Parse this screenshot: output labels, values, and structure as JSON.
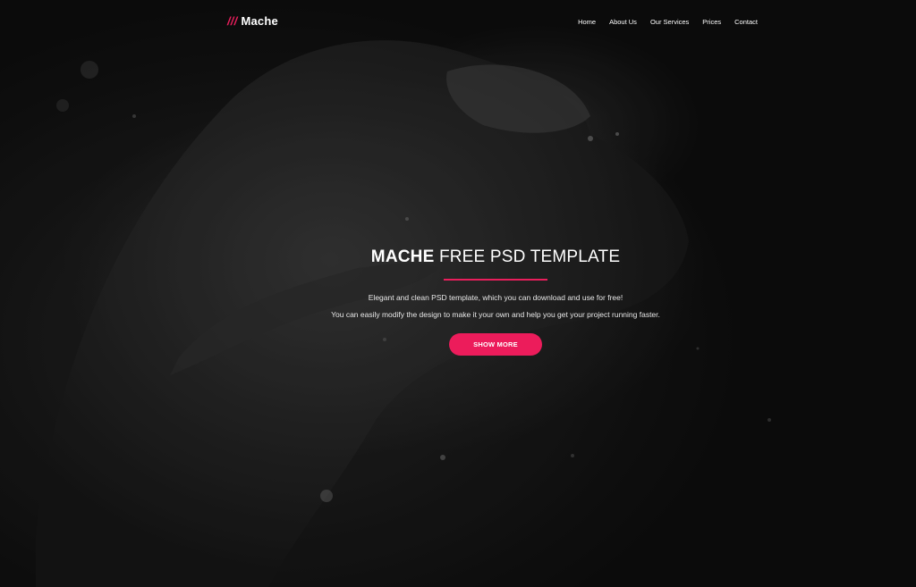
{
  "navbar": {
    "logo_slashes": "///",
    "logo_text": "Mache",
    "items": [
      {
        "label": "Home"
      },
      {
        "label": "About Us"
      },
      {
        "label": "Our Services"
      },
      {
        "label": "Prices"
      },
      {
        "label": "Contact"
      }
    ]
  },
  "hero": {
    "headline_strong": "MACHE",
    "headline_rest": " FREE PSD TEMPLATE",
    "description_line_1": "Elegant and clean PSD template, which you can download and use for free!",
    "description_line_2": "You can easily modify the design to make it your own and help you get your project running faster.",
    "button_label": "SHOW MORE"
  },
  "colors": {
    "accent": "#e91e5c",
    "background": "#0b0b0b",
    "text": "#ffffff"
  },
  "icons": {
    "background": "underwater-figure-photo"
  }
}
